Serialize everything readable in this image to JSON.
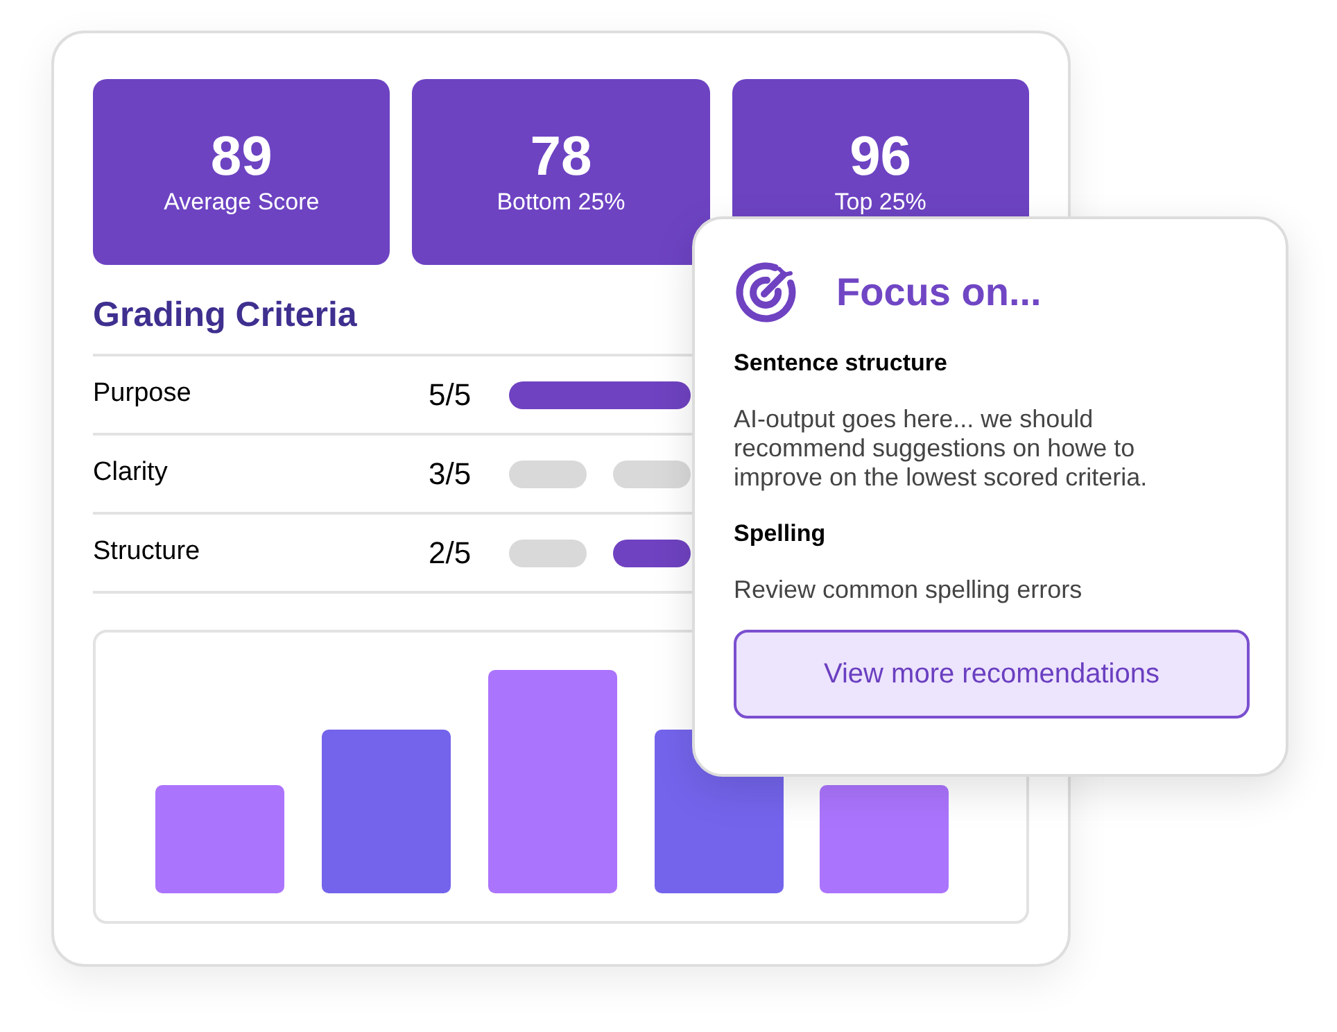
{
  "stats": [
    {
      "value": "89",
      "label": "Average Score"
    },
    {
      "value": "78",
      "label": "Bottom 25%"
    },
    {
      "value": "96",
      "label": "Top 25%"
    }
  ],
  "criteria": {
    "title": "Grading Criteria",
    "rows": [
      {
        "label": "Purpose",
        "score": "5/5",
        "segments": [
          {
            "filled": true
          },
          {
            "filled": true
          }
        ]
      },
      {
        "label": "Clarity",
        "score": "3/5",
        "segments": [
          {
            "filled": false
          },
          {
            "filled": false
          }
        ]
      },
      {
        "label": "Structure",
        "score": "2/5",
        "segments": [
          {
            "filled": false
          },
          {
            "filled": true
          }
        ]
      }
    ]
  },
  "focus": {
    "title": "Focus on...",
    "sections": [
      {
        "heading": "Sentence structure",
        "text": "AI-output goes here... we should recommend suggestions on howe to improve on the lowest scored criteria."
      },
      {
        "heading": "Spelling",
        "text": "Review common spelling errors"
      }
    ],
    "button": "View more recomendations"
  }
}
